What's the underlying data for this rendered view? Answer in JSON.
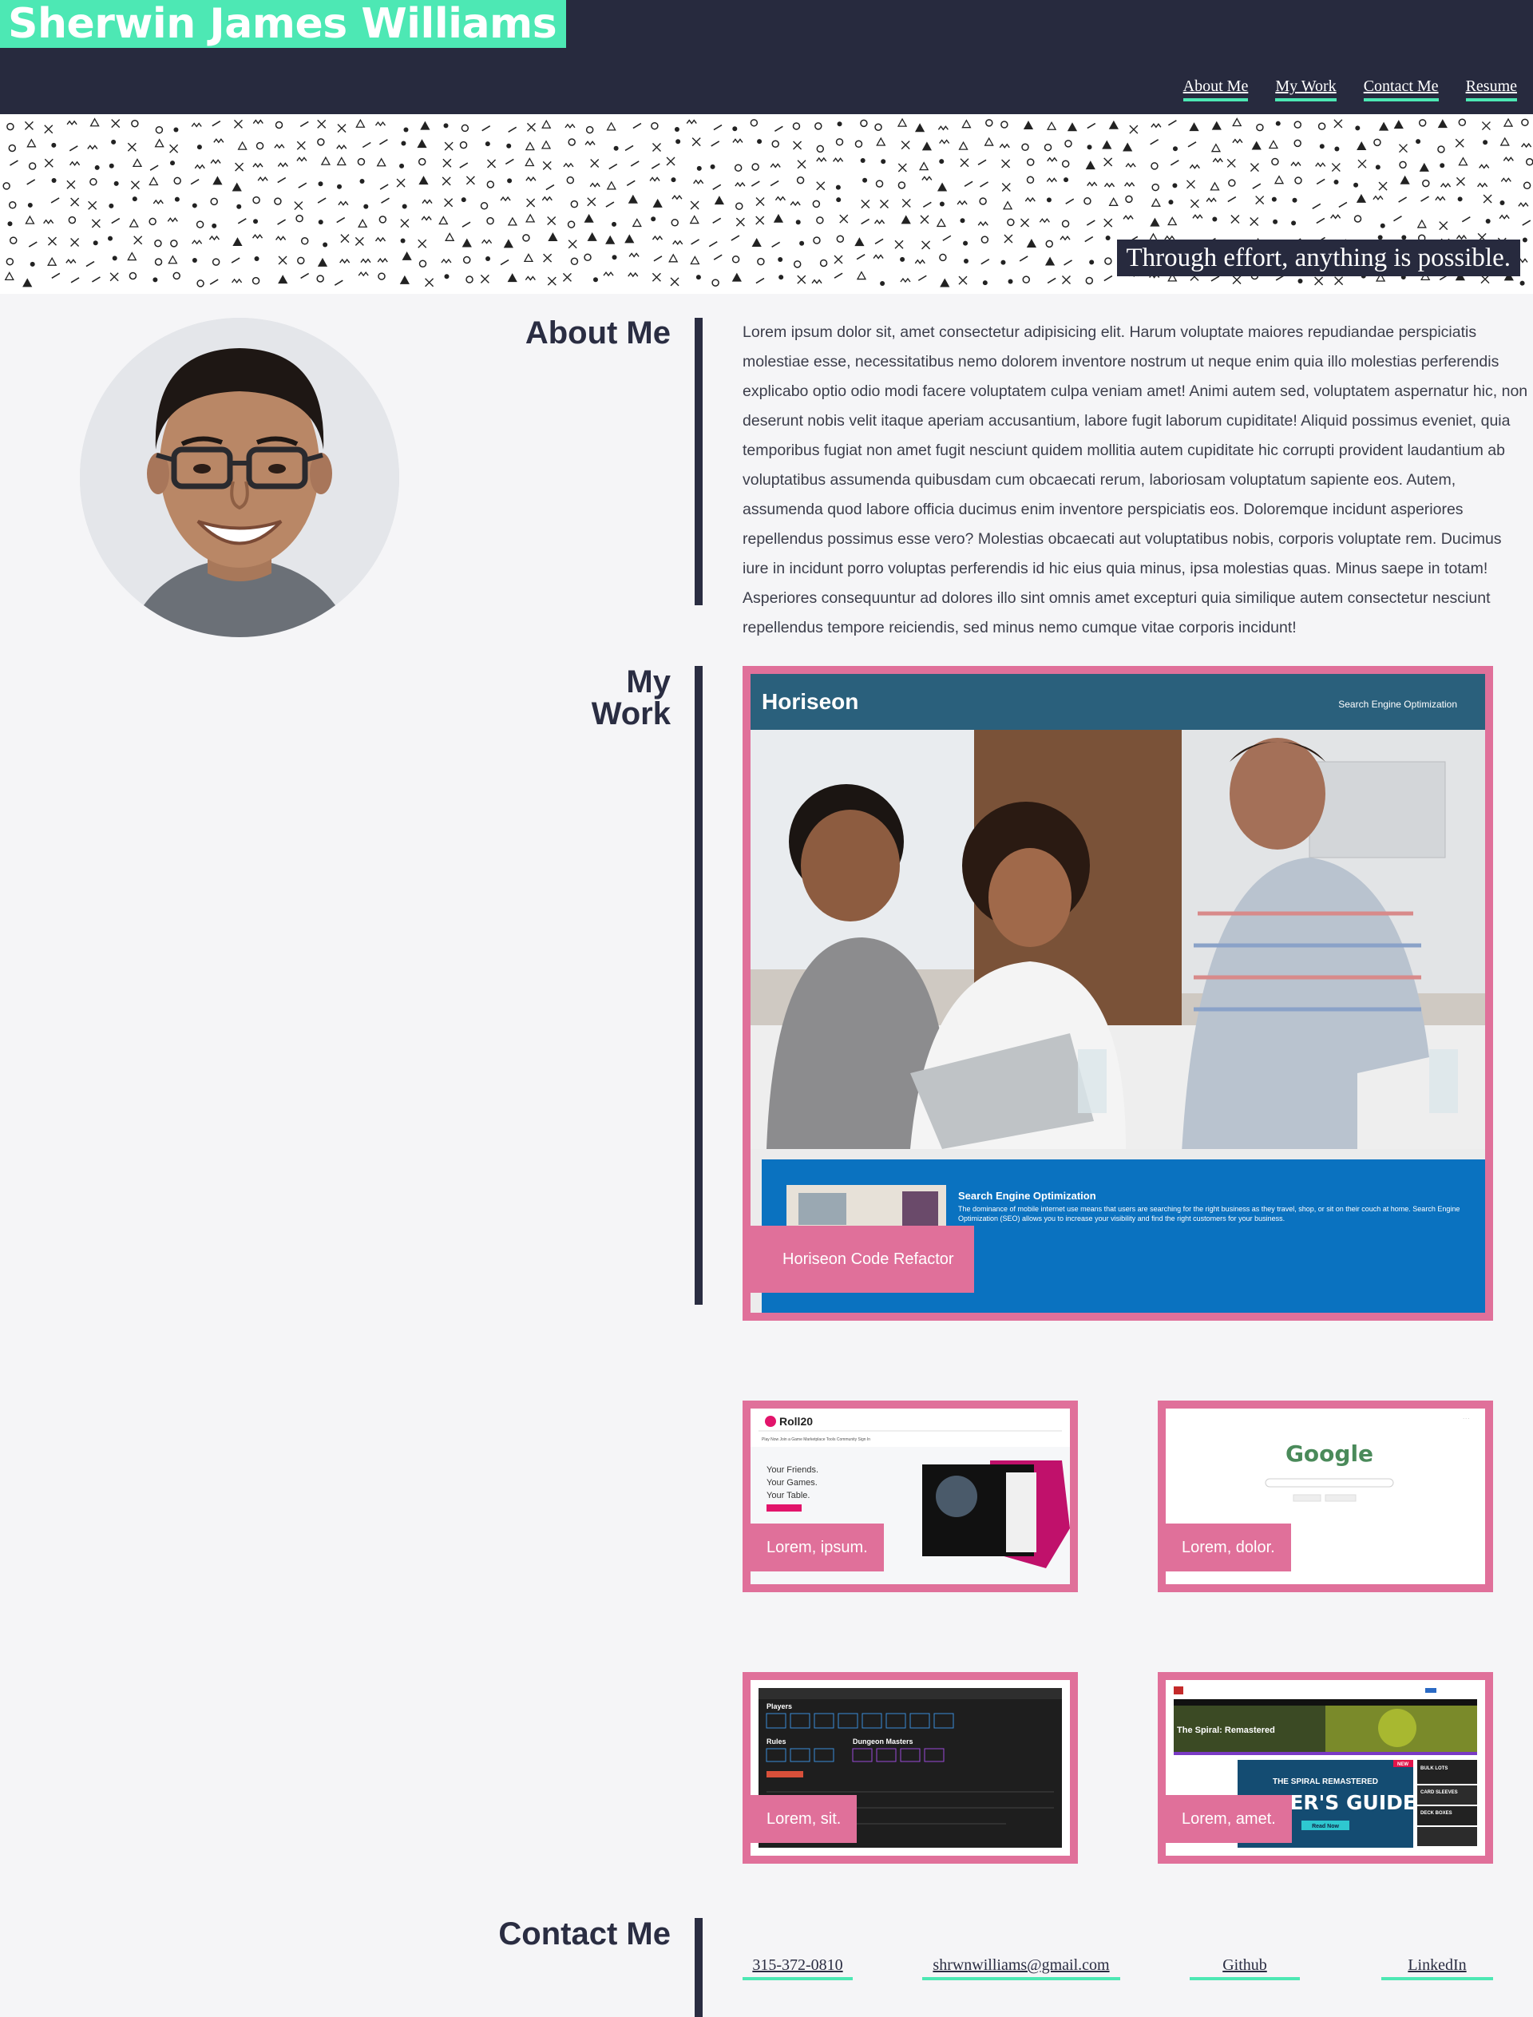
{
  "header": {
    "site_title": "Sherwin James Williams",
    "nav": [
      "About Me",
      "My Work",
      "Contact Me",
      "Resume"
    ],
    "accent_color": "#4de8b4",
    "bg_color": "#272a3e"
  },
  "banner": {
    "tagline": "Through effort, anything is possible."
  },
  "about": {
    "title": "About Me",
    "avatar_icon": "profile-photo",
    "text": "Lorem ipsum dolor sit, amet consectetur adipisicing elit. Harum voluptate maiores repudiandae perspiciatis molestiae esse, necessitatibus nemo dolorem inventore nostrum ut neque enim quia illo molestias perferendis explicabo optio odio modi facere voluptatem culpa veniam amet! Animi autem sed, voluptatem aspernatur hic, non deserunt nobis velit itaque aperiam accusantium, labore fugit laborum cupiditate! Aliquid possimus eveniet, quia temporibus fugiat non amet fugit nesciunt quidem mollitia autem cupiditate hic corrupti provident laudantium ab voluptatibus assumenda quibusdam cum obcaecati rerum, laboriosam voluptatum sapiente eos. Autem, assumenda quod labore officia ducimus enim inventore perspiciatis eos. Doloremque incidunt asperiores repellendus possimus esse vero? Molestias obcaecati aut voluptatibus nobis, corporis voluptate rem. Ducimus iure in incidunt porro voluptas perferendis id hic eius quia minus, ipsa molestias quas. Minus saepe in totam! Asperiores consequuntur ad dolores illo sint omnis amet excepturi quia similique autem consectetur nesciunt repellendus tempore reiciendis, sed minus nemo cumque vitae corporis incidunt!"
  },
  "work": {
    "title_line1": "My",
    "title_line2": "Work",
    "card_border_color": "#e0709a",
    "featured": {
      "label": "Horiseon Code Refactor",
      "screenshot": {
        "brand": "Horiseon",
        "nav_item": "Search Engine Optimization",
        "section_title": "Search Engine Optimization",
        "section_text": "The dominance of mobile internet use means that users are searching for the right business as they travel, shop, or sit on their couch at home. Search Engine Optimization (SEO) allows you to increase your visibility and find the right customers for your business."
      }
    },
    "projects": [
      {
        "label": "Lorem, ipsum.",
        "screenshot": {
          "brand": "Roll20",
          "tagline": [
            "Your Friends.",
            "Your Games.",
            "Your Table."
          ],
          "menu": [
            "Play Now",
            "Join a Game",
            "Marketplace",
            "Tools",
            "Community",
            "Sign In"
          ]
        }
      },
      {
        "label": "Lorem, dolor.",
        "screenshot": {
          "brand": "Google"
        }
      },
      {
        "label": "Lorem, sit.",
        "screenshot": {
          "heading_players": "Players",
          "heading_rules": "Rules",
          "heading_dm": "Dungeon Masters"
        }
      },
      {
        "label": "Lorem, amet.",
        "screenshot": {
          "banner_title": "The Spiral: Remastered",
          "promo_line1": "THE SPIRAL REMASTERED",
          "promo_line2": "PLAYER'S GUIDE",
          "promo_button": "Read Now",
          "badge": "NEW",
          "side_items": [
            "BULK LOTS",
            "CARD SLEEVES",
            "DECK BOXES"
          ]
        }
      }
    ]
  },
  "contact": {
    "title": "Contact Me",
    "links": [
      "315-372-0810",
      "shrwnwilliams@gmail.com",
      "Github",
      "LinkedIn"
    ]
  }
}
